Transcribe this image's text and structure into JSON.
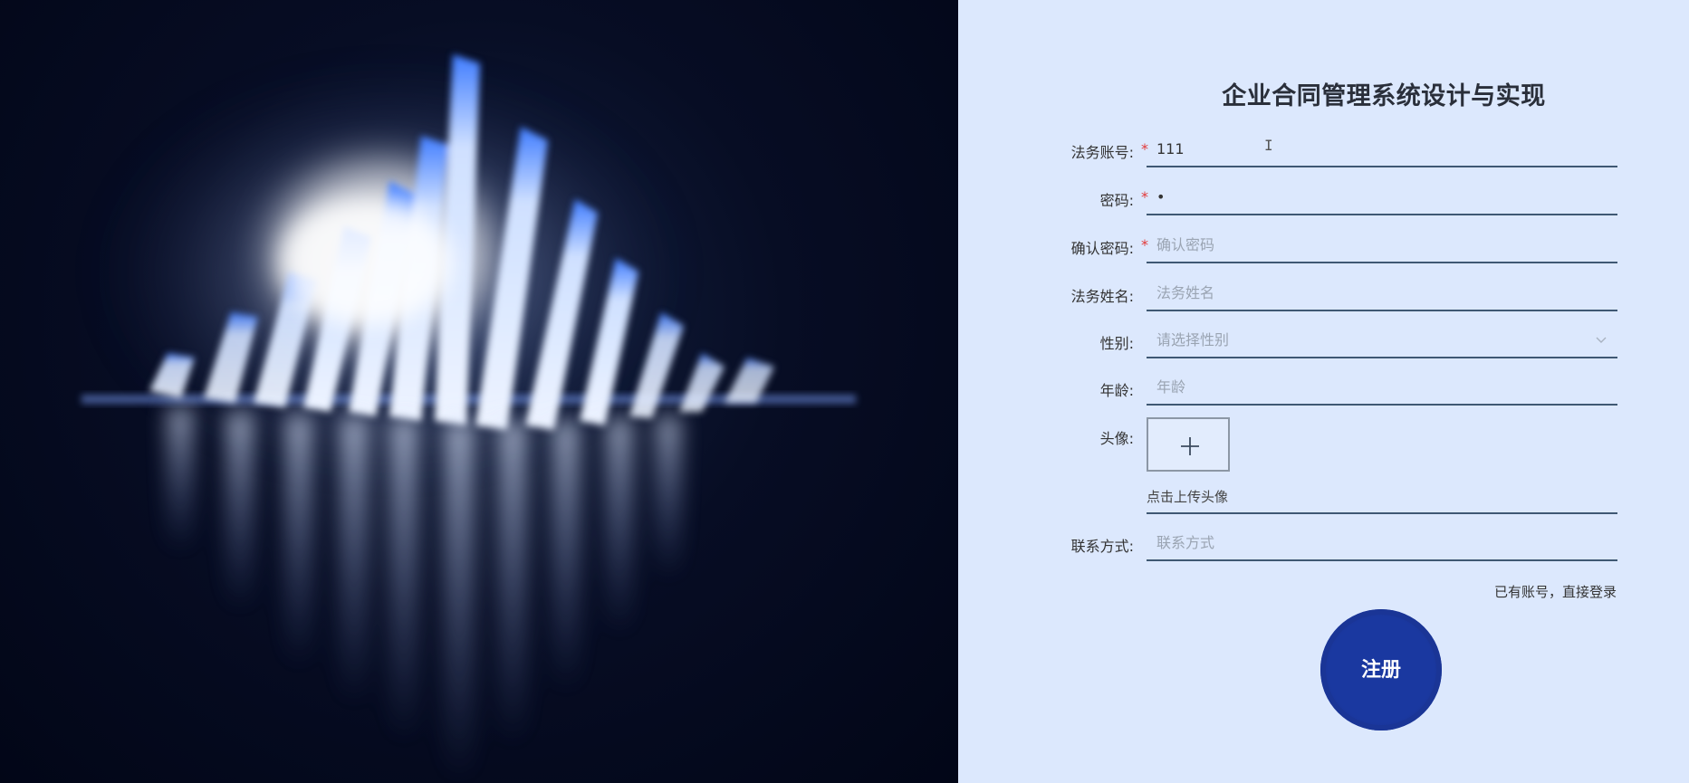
{
  "form": {
    "title": "企业合同管理系统设计与实现",
    "fields": [
      {
        "label": "法务账号:",
        "required": true,
        "value": "111",
        "placeholder": ""
      },
      {
        "label": "密码:",
        "required": true,
        "value": "•",
        "placeholder": ""
      },
      {
        "label": "确认密码:",
        "required": true,
        "value": "",
        "placeholder": "确认密码"
      },
      {
        "label": "法务姓名:",
        "required": false,
        "value": "",
        "placeholder": "法务姓名"
      },
      {
        "label": "性别:",
        "required": false,
        "value": "",
        "placeholder": "请选择性别"
      },
      {
        "label": "年龄:",
        "required": false,
        "value": "",
        "placeholder": "年龄"
      },
      {
        "label": "头像:",
        "required": false,
        "value": "",
        "placeholder": ""
      },
      {
        "label": "联系方式:",
        "required": false,
        "value": "",
        "placeholder": "联系方式"
      }
    ],
    "required_mark": "*",
    "upload_hint": "点击上传头像",
    "login_link": "已有账号，直接登录",
    "register_button": "注册"
  },
  "icons": {
    "select_chevron": "chevron-down-icon",
    "upload_plus": "plus-icon",
    "text_cursor": "i-beam-cursor-icon"
  },
  "colors": {
    "panel_bg": "#dce8fd",
    "button": "#1a38a0",
    "required": "#e23a3a",
    "underline": "#3f5873"
  }
}
